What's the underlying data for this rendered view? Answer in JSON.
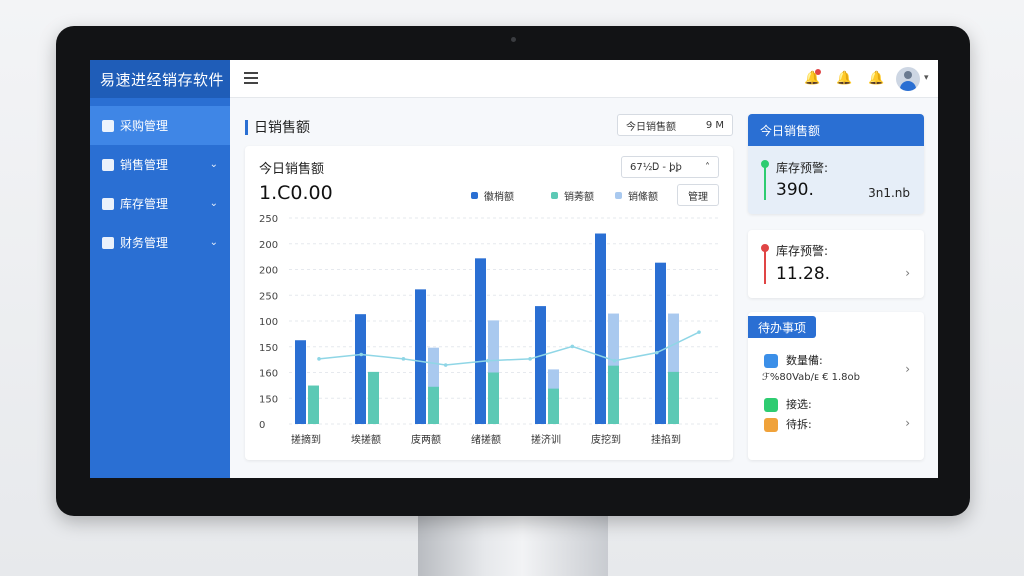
{
  "app": {
    "brand": "易速进经销存软件"
  },
  "sidebar": {
    "items": [
      {
        "label": "采购管理",
        "chevron": ""
      },
      {
        "label": "销售管理",
        "chevron": "⌄"
      },
      {
        "label": "库存管理",
        "chevron": "⌄"
      },
      {
        "label": "财务管理",
        "chevron": "⌄"
      }
    ]
  },
  "topbar": {
    "icons": [
      "menu-icon",
      "bell-icon",
      "bell-icon",
      "bell-icon",
      "avatar"
    ]
  },
  "page": {
    "title": "日销售额",
    "date_pill": {
      "label": "今日销售额",
      "value": "9 M"
    }
  },
  "chart_card": {
    "title": "今日销售额",
    "value": "1.C0.00",
    "select_label": "67½Ꭰ - ꝧꝧ",
    "select_chevron": "˄",
    "legend_button": "管理"
  },
  "chart_data": {
    "type": "bar",
    "categories": [
      "搓摘到",
      "埃搓额",
      "庋两额",
      "绪搓额",
      "搓济训",
      "庋挖到",
      "挂掐到"
    ],
    "series": [
      {
        "name": "徽梢额",
        "color": "#2a6fd3",
        "values": [
          135,
          177,
          217,
          267,
          190,
          307,
          260
        ]
      },
      {
        "name": "销莠额",
        "color": "#5cc9b5",
        "values": [
          62,
          84,
          60,
          83,
          57,
          94,
          84
        ]
      },
      {
        "name": "销絛额",
        "color": "#a9c9ef",
        "values": [
          0,
          0,
          123,
          167,
          88,
          178,
          178
        ]
      }
    ],
    "line": {
      "color": "#8fd6e6",
      "values": [
        105,
        112,
        105,
        95,
        102,
        105,
        125,
        102,
        115,
        148
      ]
    },
    "y_tick_labels": [
      "250",
      "200",
      "200",
      "250",
      "100",
      "150",
      "160",
      "150",
      "0"
    ],
    "ylim": [
      0,
      332
    ],
    "grid": true
  },
  "kpi": {
    "header": "今日销售额",
    "label": "库存预警:",
    "value": "390.",
    "extra": "3n1.nb",
    "accent": "#2ecc71"
  },
  "alert": {
    "label": "库存预警:",
    "value": "11.28.",
    "accent": "#e04545"
  },
  "todo": {
    "header": "待办事项",
    "items": [
      {
        "label": "数量備:",
        "sub": "ℱ%80Vab/ᴇ € 1.8ᴏb"
      },
      {
        "label": "接选:",
        "sub": ""
      },
      {
        "label": "待拆:",
        "sub": ""
      }
    ]
  }
}
